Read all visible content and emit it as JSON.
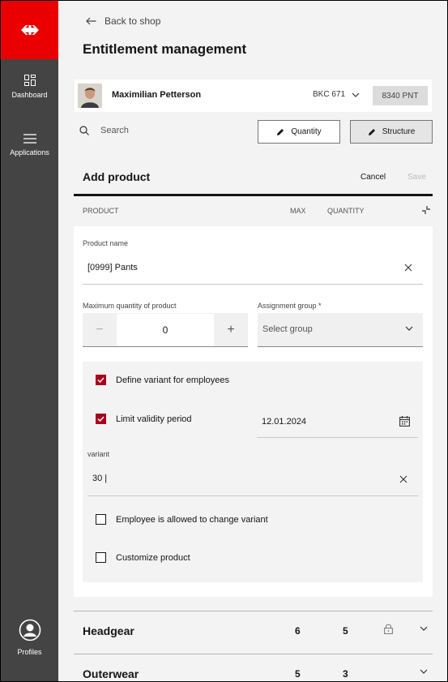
{
  "sidebar": {
    "items": [
      {
        "label": "Dashboard",
        "icon": "dashboard-icon"
      },
      {
        "label": "Applications",
        "icon": "menu-icon"
      }
    ],
    "profile_label": "Profiles",
    "brand_color": "#eb0000"
  },
  "header": {
    "back_label": "Back to shop",
    "title": "Entitlement management"
  },
  "user": {
    "name": "Maximilian Petterson",
    "code": "BKC 671",
    "points": "8340 PNT"
  },
  "toolbar": {
    "search_placeholder": "Search",
    "quantity_label": "Quantity",
    "structure_label": "Structure"
  },
  "add_product": {
    "title": "Add product",
    "cancel_label": "Cancel",
    "save_label": "Save"
  },
  "columns": {
    "product": "PRODUCT",
    "max": "MAX",
    "quantity": "QUANTITY"
  },
  "form": {
    "product_name_label": "Product name",
    "product_name_value": "[0999] Pants",
    "max_qty_label": "Maximum quantity of product",
    "max_qty_value": "0",
    "minus": "−",
    "plus": "+",
    "assignment_label": "Assignment group *",
    "assignment_placeholder": "Select group",
    "define_variant_label": "Define variant for employees",
    "define_variant_checked": true,
    "limit_validity_label": "Limit validity period",
    "limit_validity_checked": true,
    "validity_date": "12.01.2024",
    "variant_label": "variant",
    "variant_value": "30 |",
    "allow_change_label": "Employee is allowed to change variant",
    "allow_change_checked": false,
    "customize_label": "Customize product",
    "customize_checked": false
  },
  "categories": [
    {
      "name": "Headgear",
      "max": "6",
      "qty": "5",
      "locked": true
    },
    {
      "name": "Outerwear",
      "max": "5",
      "qty": "3",
      "locked": false
    }
  ],
  "colors": {
    "accent_red": "#eb0000",
    "checkbox_red": "#a8001d",
    "sidebar_bg": "#444444"
  }
}
